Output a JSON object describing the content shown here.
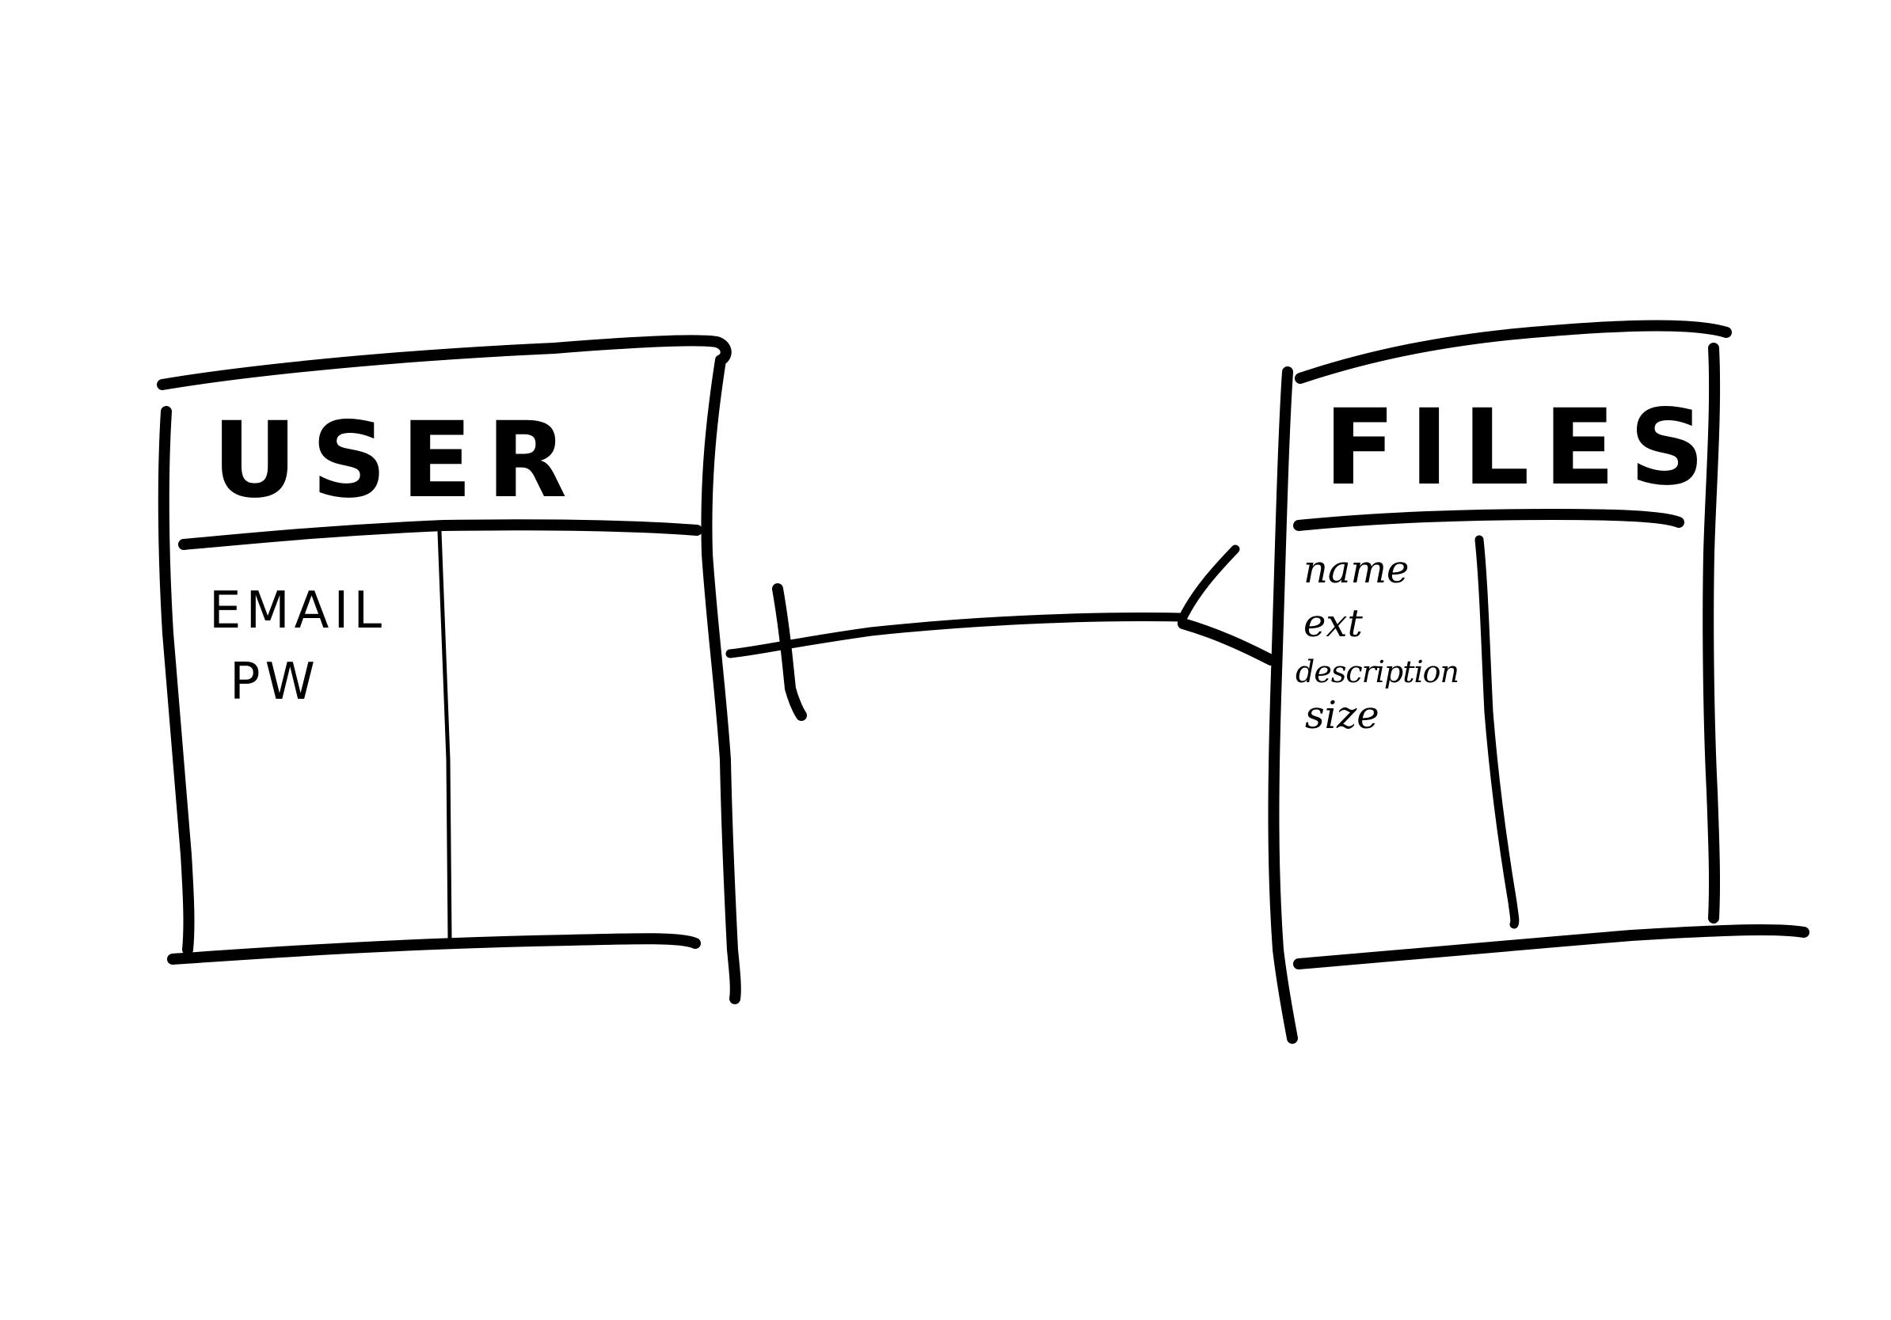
{
  "colors": {
    "background": "#ffffff",
    "ink": "#000000"
  },
  "entities": [
    {
      "id": "user",
      "title": "USER",
      "attributes": [
        "EMAIL",
        "PW"
      ]
    },
    {
      "id": "files",
      "title": "FILES",
      "attributes": [
        "name",
        "ext",
        "description",
        "size"
      ]
    }
  ],
  "relationship": {
    "from": "USER",
    "to": "FILES",
    "from_end": "one",
    "to_end": "many"
  }
}
